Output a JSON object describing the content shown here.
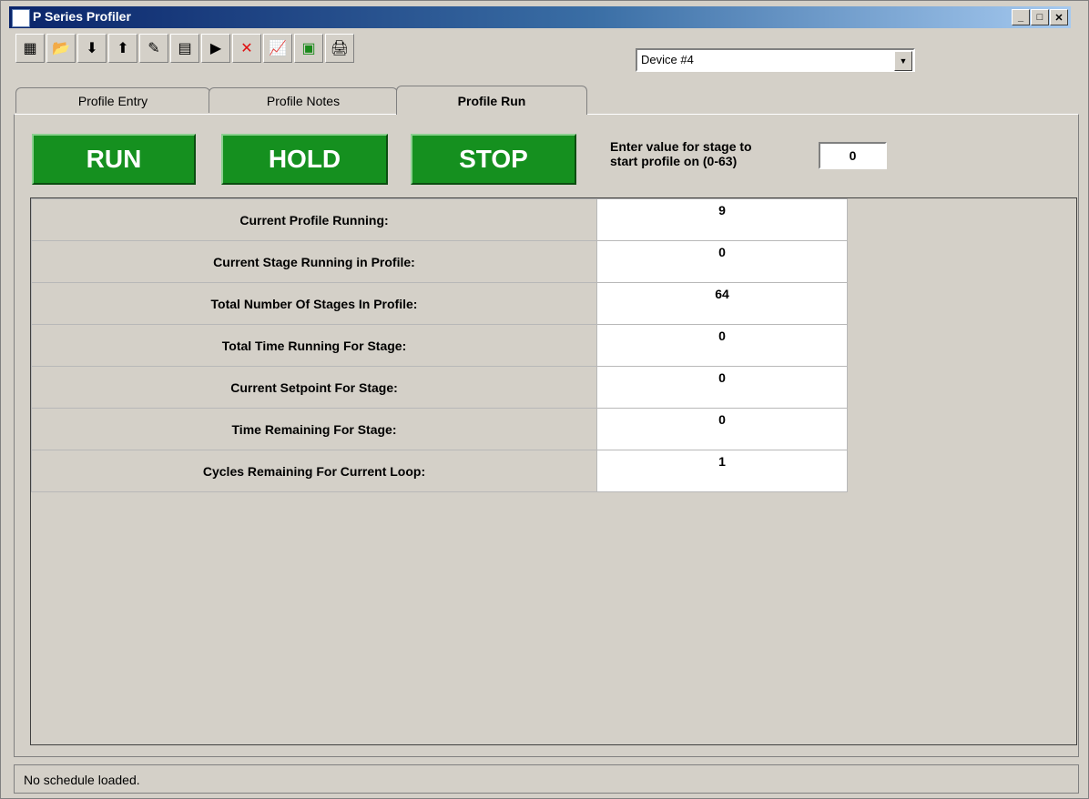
{
  "window": {
    "title": "P Series Profiler"
  },
  "toolbar": {
    "icons": [
      "table-icon",
      "folder-icon",
      "import-icon",
      "export-icon",
      "write-icon",
      "grid-icon",
      "play-step-icon",
      "delete-icon",
      "chart-icon",
      "save-icon",
      "print-icon"
    ],
    "glyphs": [
      "▦",
      "📂",
      "⬇",
      "⬆",
      "✎",
      "▤",
      "▶",
      "✕",
      "📈",
      "▣",
      "🖨"
    ]
  },
  "device": {
    "selected": "Device #4"
  },
  "tabs": [
    "Profile Entry",
    "Profile Notes",
    "Profile Run"
  ],
  "controls": {
    "run": "RUN",
    "hold": "HOLD",
    "stop": "STOP",
    "stage_label_1": "Enter value for stage to",
    "stage_label_2": "start profile on (0-63)",
    "stage_value": "0"
  },
  "stats": [
    {
      "label": "Current Profile Running:",
      "value": "9"
    },
    {
      "label": "Current Stage Running in Profile:",
      "value": "0"
    },
    {
      "label": "Total Number Of Stages In Profile:",
      "value": "64"
    },
    {
      "label": "Total Time Running For Stage:",
      "value": "0"
    },
    {
      "label": "Current Setpoint For Stage:",
      "value": "0"
    },
    {
      "label": "Time Remaining For Stage:",
      "value": "0"
    },
    {
      "label": "Cycles Remaining For Current Loop:",
      "value": "1"
    }
  ],
  "status": {
    "text": "No schedule loaded."
  },
  "colors": {
    "accent_green": "#15901f",
    "titlebar": "#0a246a"
  }
}
